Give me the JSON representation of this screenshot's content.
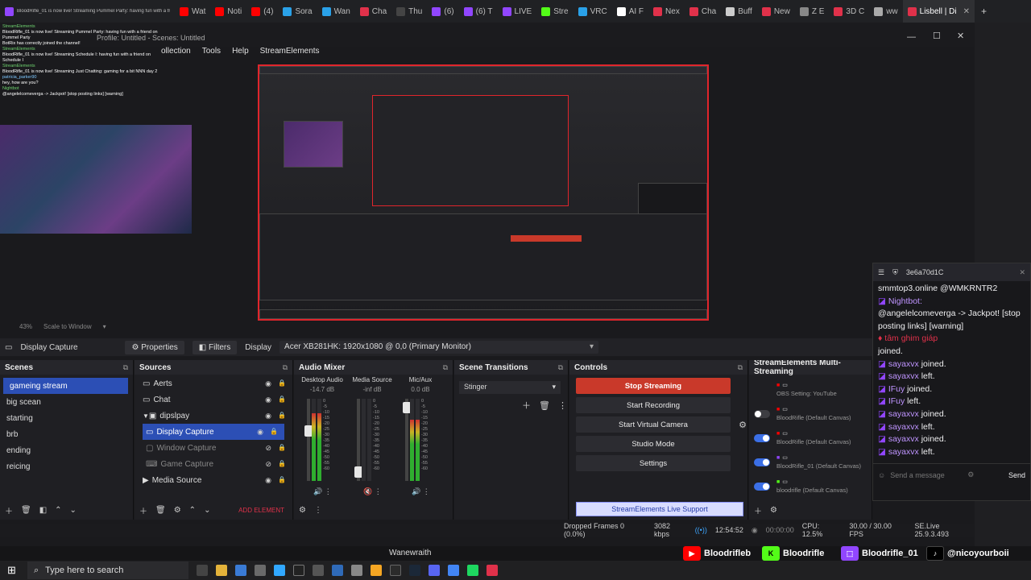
{
  "browser": {
    "tabs": [
      {
        "label": "BloodRifle_01 is now live! Streaming Pummel Party: having fun with a friend on",
        "color": "#9146ff"
      },
      {
        "label": "Wat",
        "color": "#ff0000"
      },
      {
        "label": "Noti",
        "color": "#ff0000"
      },
      {
        "label": "(4)",
        "color": "#ff0000"
      },
      {
        "label": "Sora",
        "color": "#2aa1e8"
      },
      {
        "label": "Wan",
        "color": "#2aa1e8"
      },
      {
        "label": "Cha",
        "color": "#e0314a"
      },
      {
        "label": "Thu",
        "color": "#444"
      },
      {
        "label": "(6)",
        "color": "#9146ff"
      },
      {
        "label": "(6) T",
        "color": "#9146ff"
      },
      {
        "label": "LIVE",
        "color": "#9146ff"
      },
      {
        "label": "Stre",
        "color": "#53fc18"
      },
      {
        "label": "VRC",
        "color": "#2aa1e8"
      },
      {
        "label": "AI F",
        "color": "#fff"
      },
      {
        "label": "Nex",
        "color": "#e0314a"
      },
      {
        "label": "Cha",
        "color": "#e0314a"
      },
      {
        "label": "Buff",
        "color": "#ccc"
      },
      {
        "label": "New",
        "color": "#e0314a"
      },
      {
        "label": "Z E",
        "color": "#888"
      },
      {
        "label": "3D C",
        "color": "#e0314a"
      },
      {
        "label": "ww",
        "color": "#aaa"
      },
      {
        "label": "Lisbell | Di",
        "color": "#e0314a",
        "active": true
      }
    ]
  },
  "overlay_chat": [
    {
      "user": "StreamElements",
      "text": "BloodRifle_01 is now live! Streaming Pummel Party: having fun with a friend on Pummel Party",
      "cls": "g"
    },
    {
      "user": "",
      "text": "BotRix has correctly joined the channel!",
      "cls": ""
    },
    {
      "user": "StreamElements",
      "text": "BloodRifle_01 is now live! Streaming Schedule I: having fun with a friend on Schedule I",
      "cls": "g"
    },
    {
      "user": "StreamElements",
      "text": "BloodRifle_01 is now live! Streaming Just Chatting: gaming for a bit NNN day 2",
      "cls": "g"
    },
    {
      "user": "patricia_parker90",
      "text": "hey, how are you?",
      "cls": ""
    },
    {
      "user": "Nightbot",
      "text": "@angelelcomeverga -> Jackpot! [stop posting links] [warning]",
      "cls": "g"
    }
  ],
  "obs": {
    "title": "Profile: Untitled - Scenes: Untitled",
    "menu": [
      "ollection",
      "Tools",
      "Help",
      "StreamElements"
    ],
    "zoom": "43%",
    "scale_mode": "Scale to Window",
    "context": {
      "source": "Display Capture",
      "properties": "Properties",
      "filters": "Filters",
      "display_label": "Display",
      "display_value": "Acer XB281HK: 1920x1080 @ 0,0 (Primary Monitor)"
    },
    "scenes": {
      "title": "Scenes",
      "items": [
        {
          "label": "gameing stream",
          "selected": true
        },
        {
          "label": "big scean"
        },
        {
          "label": "starting"
        },
        {
          "label": "brb"
        },
        {
          "label": "ending"
        },
        {
          "label": "reicing"
        }
      ]
    },
    "sources": {
      "title": "Sources",
      "add_element": "ADD ELEMENT",
      "items": [
        {
          "label": "Aerts",
          "indent": 0,
          "icon": "monitor",
          "dim": false,
          "sel": false
        },
        {
          "label": "Chat",
          "indent": 0,
          "icon": "monitor",
          "dim": false,
          "sel": false
        },
        {
          "label": "dipslpay",
          "indent": 0,
          "icon": "folder",
          "dim": false,
          "sel": false,
          "group": true
        },
        {
          "label": "Display Capture",
          "indent": 1,
          "icon": "monitor",
          "dim": false,
          "sel": true
        },
        {
          "label": "Window Capture",
          "indent": 1,
          "icon": "window",
          "dim": true,
          "sel": false
        },
        {
          "label": "Game Capture",
          "indent": 1,
          "icon": "gamepad",
          "dim": true,
          "sel": false
        },
        {
          "label": "Media Source",
          "indent": 0,
          "icon": "play",
          "dim": false,
          "sel": false
        }
      ]
    },
    "mixer": {
      "title": "Audio Mixer",
      "channels": [
        {
          "name": "Desktop Audio",
          "db": "-14.7 dB",
          "level": 0.82,
          "fader": 0.62
        },
        {
          "name": "Media Source",
          "db": "-inf dB",
          "level": 0.0,
          "fader": 0.05
        },
        {
          "name": "Mic/Aux",
          "db": "0.0 dB",
          "level": 0.75,
          "fader": 0.95
        }
      ],
      "scale": [
        "0",
        "-5",
        "-10",
        "-15",
        "-20",
        "-25",
        "-30",
        "-35",
        "-40",
        "-45",
        "-50",
        "-55",
        "-60"
      ]
    },
    "transitions": {
      "title": "Scene Transitions",
      "selected": "Stinger"
    },
    "controls": {
      "title": "Controls",
      "stop_streaming": "Stop Streaming",
      "start_recording": "Start Recording",
      "start_virtual_camera": "Start Virtual Camera",
      "studio_mode": "Studio Mode",
      "settings": "Settings",
      "support": "StreamElements Live Support"
    },
    "multistream": {
      "title": "StreamElements Multi-Streaming",
      "rows": [
        {
          "label": "OBS Setting: YouTube",
          "on": null
        },
        {
          "label": "BloodRifle (Default Canvas)",
          "on": false
        },
        {
          "label": "BloodRifle (Default Canvas)",
          "on": true
        },
        {
          "label": "BloodRifle_01 (Default Canvas)",
          "on": true
        },
        {
          "label": "bloodrifle (Default Canvas)",
          "on": true
        }
      ]
    },
    "status": {
      "dropped": "Dropped Frames 0 (0.0%)",
      "bitrate": "3082 kbps",
      "live_time": "12:54:52",
      "rec_time": "00:00:00",
      "cpu": "CPU: 12.5%",
      "fps": "30.00 / 30.00 FPS",
      "version": "SE.Live 25.9.3.493"
    }
  },
  "twitch_chat": {
    "title": "3e6a70d1C",
    "lines": [
      {
        "user": "",
        "text": "smmtop3.online @WMKRNTR2",
        "cls": ""
      },
      {
        "user": "Nightbot:",
        "text": "",
        "cls": "n"
      },
      {
        "user": "",
        "text": "@angelelcomeverga -> Jackpot! [stop",
        "cls": ""
      },
      {
        "user": "",
        "text": "posting links] [warning]",
        "cls": ""
      },
      {
        "user": "tâm ghim giáp",
        "text": "",
        "cls": "g"
      },
      {
        "user": "",
        "text": "joined.",
        "cls": ""
      },
      {
        "user": "sayaxvx",
        "text": " joined.",
        "cls": ""
      },
      {
        "user": "sayaxvx",
        "text": " left.",
        "cls": ""
      },
      {
        "user": "IFuy",
        "text": " joined.",
        "cls": ""
      },
      {
        "user": "IFuy",
        "text": " left.",
        "cls": ""
      },
      {
        "user": "sayaxvx",
        "text": " joined.",
        "cls": ""
      },
      {
        "user": "sayaxvx",
        "text": " left.",
        "cls": ""
      },
      {
        "user": "sayaxvx",
        "text": " joined.",
        "cls": ""
      },
      {
        "user": "sayaxvx",
        "text": " left.",
        "cls": ""
      }
    ],
    "placeholder": "Send a message",
    "send": "Send"
  },
  "stream_overlay": {
    "youtube": "Bloodrifleb",
    "kick": "Bloodrifle",
    "twitch": "Bloodrifle_01",
    "tiktok": "@nicoyourboii",
    "caption": "Wanewraith"
  },
  "taskbar": {
    "search_placeholder": "Type here to search"
  },
  "colors": {
    "accent": "#2c4fb5",
    "stop_red": "#c9392a",
    "preview_border": "#e0252c",
    "twitch": "#9146ff"
  }
}
